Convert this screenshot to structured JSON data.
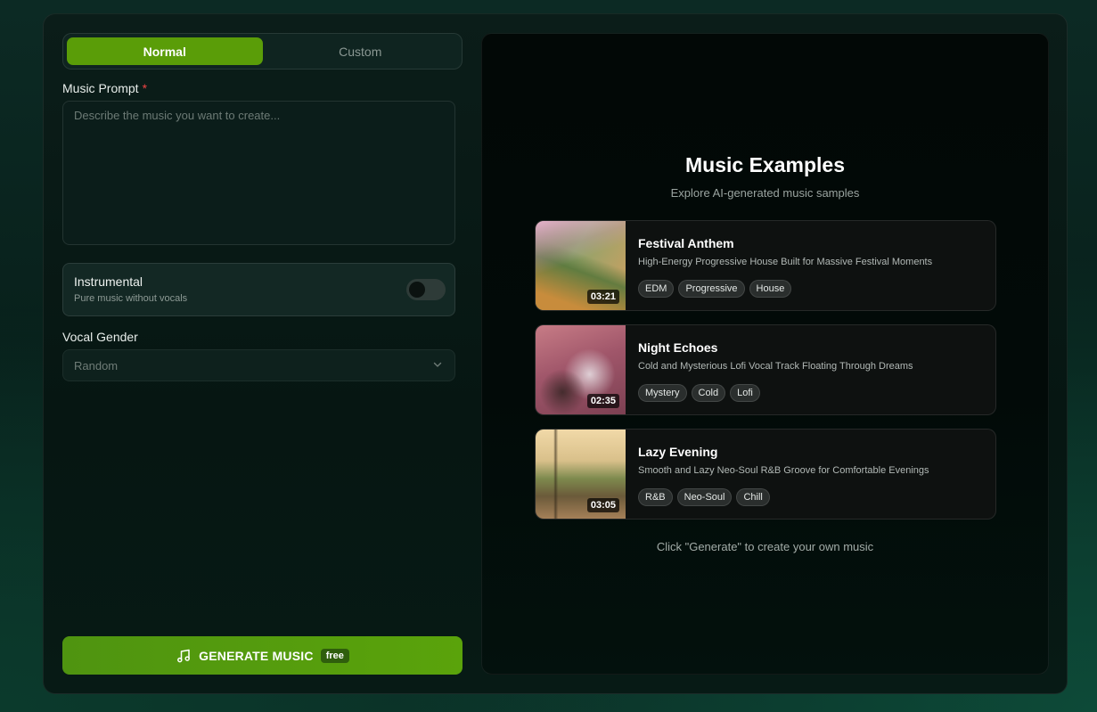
{
  "mode_tabs": [
    {
      "label": "Normal",
      "active": true
    },
    {
      "label": "Custom",
      "active": false
    }
  ],
  "prompt": {
    "label": "Music Prompt",
    "required_mark": "*",
    "placeholder": "Describe the music you want to create...",
    "value": ""
  },
  "instrumental": {
    "title": "Instrumental",
    "subtitle": "Pure music without vocals",
    "enabled": false
  },
  "vocal_gender": {
    "label": "Vocal Gender",
    "selected": "Random"
  },
  "generate": {
    "label": "GENERATE MUSIC",
    "badge": "free",
    "icon": "music-note-icon"
  },
  "examples": {
    "title": "Music Examples",
    "subtitle": "Explore AI-generated music samples",
    "hint": "Click \"Generate\" to create your own music",
    "tracks": [
      {
        "name": "Festival Anthem",
        "description": "High-Energy Progressive House Built for Massive Festival Moments",
        "duration": "03:21",
        "tags": [
          "EDM",
          "Progressive",
          "House"
        ]
      },
      {
        "name": "Night Echoes",
        "description": "Cold and Mysterious Lofi Vocal Track Floating Through Dreams",
        "duration": "02:35",
        "tags": [
          "Mystery",
          "Cold",
          "Lofi"
        ]
      },
      {
        "name": "Lazy Evening",
        "description": "Smooth and Lazy Neo-Soul R&B Groove for Comfortable Evenings",
        "duration": "03:05",
        "tags": [
          "R&B",
          "Neo-Soul",
          "Chill"
        ]
      }
    ]
  },
  "colors": {
    "accent": "#5a9d08",
    "required": "#ef4444"
  }
}
